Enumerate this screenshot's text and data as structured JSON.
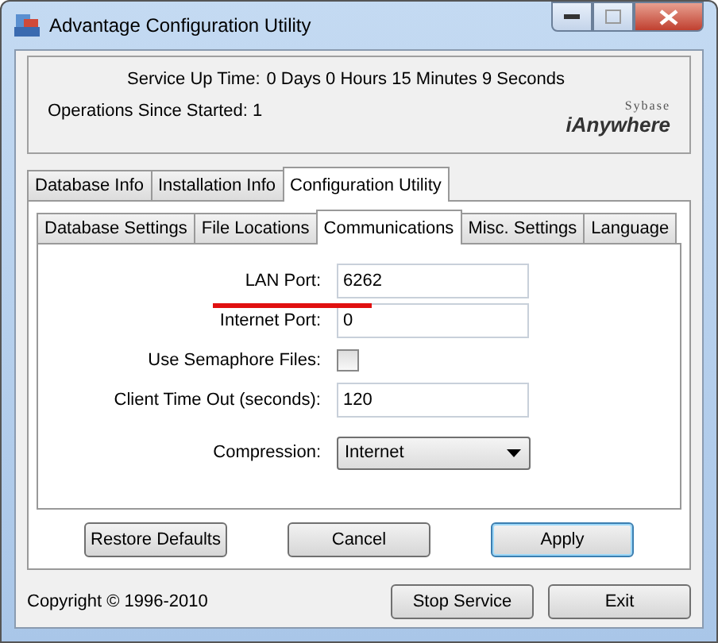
{
  "window": {
    "title": "Advantage Configuration Utility"
  },
  "status": {
    "uptime_label": "Service Up Time:",
    "uptime_value": "0 Days 0 Hours 15 Minutes 9 Seconds",
    "operations": "Operations Since Started: 1",
    "logo_top": "Sybase",
    "logo_main": "iAnywhere"
  },
  "tabs": [
    {
      "label": "Database Info",
      "selected": false
    },
    {
      "label": "Installation Info",
      "selected": false
    },
    {
      "label": "Configuration Utility",
      "selected": true
    }
  ],
  "subtabs": [
    {
      "label": "Database Settings",
      "selected": false
    },
    {
      "label": "File Locations",
      "selected": false
    },
    {
      "label": "Communications",
      "selected": true
    },
    {
      "label": "Misc. Settings",
      "selected": false
    },
    {
      "label": "Language",
      "selected": false
    }
  ],
  "fields": [
    {
      "kind": "text",
      "label": "LAN Port:",
      "value": "6262",
      "highlighted": true
    },
    {
      "kind": "text",
      "label": "Internet Port:",
      "value": "0",
      "highlighted": false
    },
    {
      "kind": "checkbox",
      "label": "Use Semaphore Files:",
      "checked": false
    },
    {
      "kind": "text",
      "label": "Client Time Out (seconds):",
      "value": "120",
      "highlighted": false
    },
    {
      "kind": "select",
      "label": "Compression:",
      "value": "Internet"
    }
  ],
  "panel_buttons": [
    {
      "label": "Restore Defaults",
      "default": false
    },
    {
      "label": "Cancel",
      "default": false
    },
    {
      "label": "Apply",
      "default": true
    }
  ],
  "copyright": "Copyright © 1996-2010",
  "footer_buttons": [
    "Stop Service",
    "Exit"
  ]
}
